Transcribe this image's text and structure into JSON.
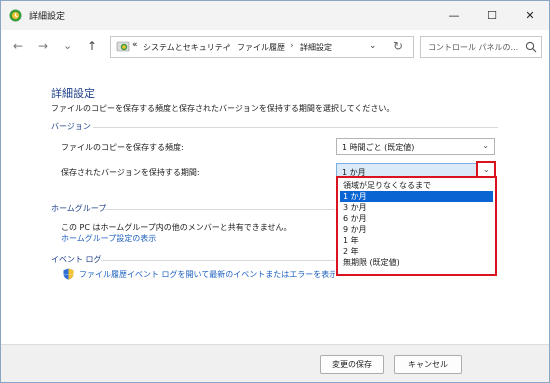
{
  "window": {
    "title": "詳細設定"
  },
  "titlebar_buttons": {
    "minimize": "—",
    "maximize": "☐",
    "close": "✕"
  },
  "nav": {
    "back": "←",
    "forward": "→",
    "recent": "⌄",
    "up": "↑",
    "address": {
      "prefix": "«",
      "segments": [
        "システムとセキュリティ",
        "ファイル履歴",
        "詳細設定"
      ],
      "separator": "›",
      "dropdown": "⌄",
      "refresh": "↻"
    },
    "search": {
      "placeholder": "コントロール パネルの..."
    }
  },
  "main": {
    "heading": "詳細設定",
    "description": "ファイルのコピーを保存する頻度と保存されたバージョンを保持する期間を選択してください。",
    "versions": {
      "title": "バージョン",
      "frequency_label": "ファイルのコピーを保存する頻度:",
      "frequency_value": "1 時間ごと (既定値)",
      "retention_label": "保存されたバージョンを保持する期間:",
      "retention_value": "1 か月"
    },
    "homegroup": {
      "title": "ホームグループ",
      "text": "この PC はホームグループ内の他のメンバーと共有できません。",
      "link": "ホームグループ設定の表示"
    },
    "eventlog": {
      "title": "イベント ログ",
      "link": "ファイル履歴イベント ログを開いて最新のイベントまたはエラーを表示する"
    }
  },
  "dropdown": {
    "options": [
      "領域が足りなくなるまで",
      "1 か月",
      "3 か月",
      "6 か月",
      "9 か月",
      "1 年",
      "2 年",
      "無期限 (既定値)"
    ],
    "selected_index": 1
  },
  "footer": {
    "save": "変更の保存",
    "cancel": "キャンセル"
  },
  "colors": {
    "accent": "#0a64d2",
    "heading": "#1e3f8a",
    "link": "#1b5fbf",
    "highlight_border": "#d9141e"
  }
}
